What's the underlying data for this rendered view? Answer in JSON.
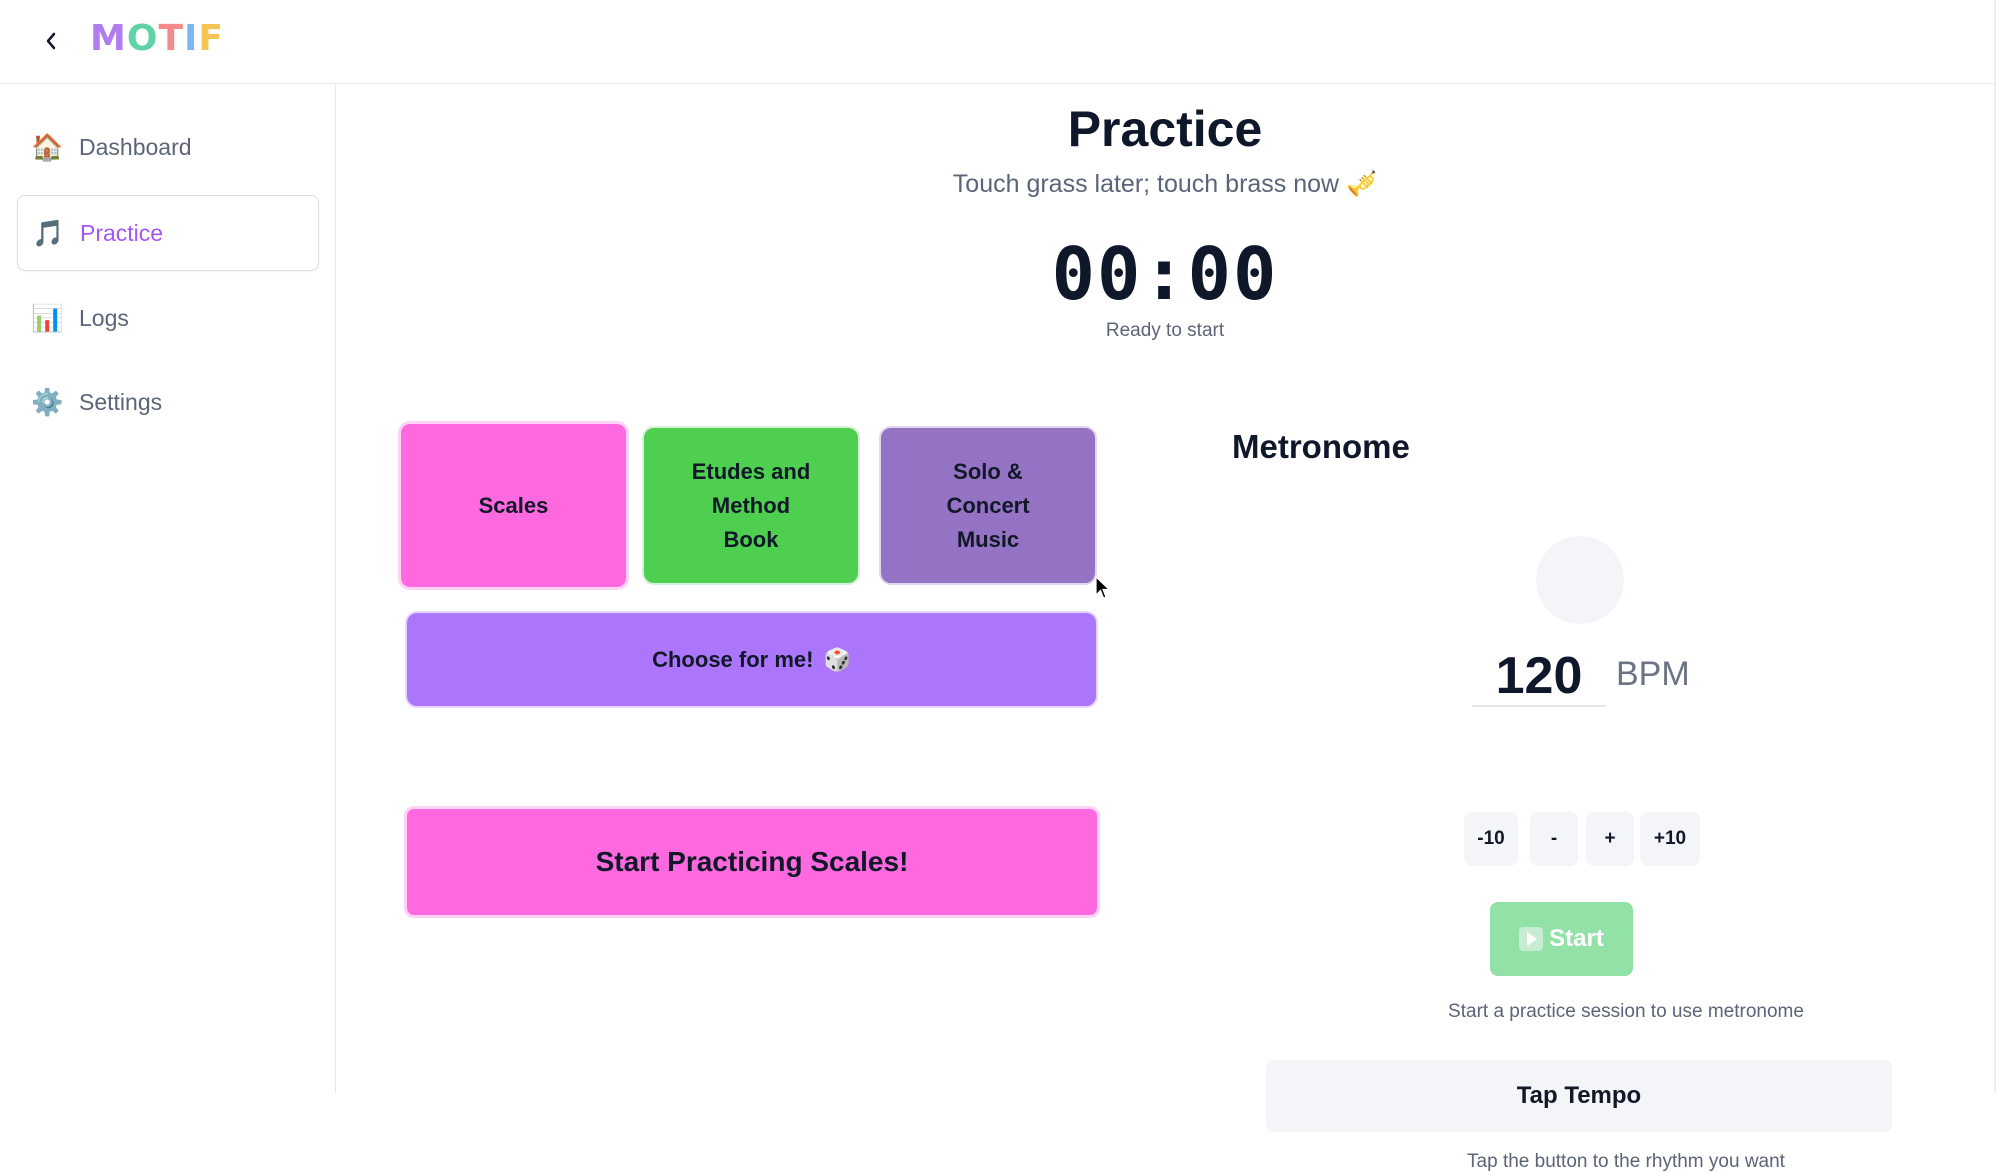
{
  "app": {
    "logo_letters": [
      "M",
      "O",
      "T",
      "I",
      "F"
    ],
    "logo_colors": [
      "#b07cf0",
      "#5fd3a6",
      "#f48a8a",
      "#7fb5f5",
      "#f5c453"
    ]
  },
  "sidebar": {
    "items": [
      {
        "label": "Dashboard",
        "icon": "🏠",
        "icon_name": "house-icon",
        "active": false
      },
      {
        "label": "Practice",
        "icon": "🎵",
        "icon_name": "music-note-icon",
        "active": true
      },
      {
        "label": "Logs",
        "icon": "📊",
        "icon_name": "bar-chart-icon",
        "active": false
      },
      {
        "label": "Settings",
        "icon": "⚙️",
        "icon_name": "gear-icon",
        "active": false
      }
    ]
  },
  "practice": {
    "title": "Practice",
    "subtitle": "Touch grass later; touch brass now 🎺",
    "timer": "00:00",
    "status": "Ready to start",
    "categories": [
      {
        "label": "Scales",
        "color": "#ff69e0",
        "selected": true
      },
      {
        "label": "Etudes and Method Book",
        "line1": "Etudes and",
        "line2": "Method",
        "line3": "Book",
        "color": "#4ecf50"
      },
      {
        "label": "Solo & Concert Music",
        "line1": "Solo &",
        "line2": "Concert",
        "line3": "Music",
        "color": "#9573c4"
      }
    ],
    "choose_label": "Choose for me!",
    "choose_icon": "🎲",
    "start_label": "Start Practicing Scales!"
  },
  "metronome": {
    "title": "Metronome",
    "bpm": "120",
    "bpm_unit": "BPM",
    "steps": [
      "-10",
      "-",
      "+",
      "+10"
    ],
    "start_label": "Start",
    "hint": "Start a practice session to use metronome",
    "tap_label": "Tap Tempo",
    "tap_hint": "Tap the button to the rhythm you want"
  }
}
